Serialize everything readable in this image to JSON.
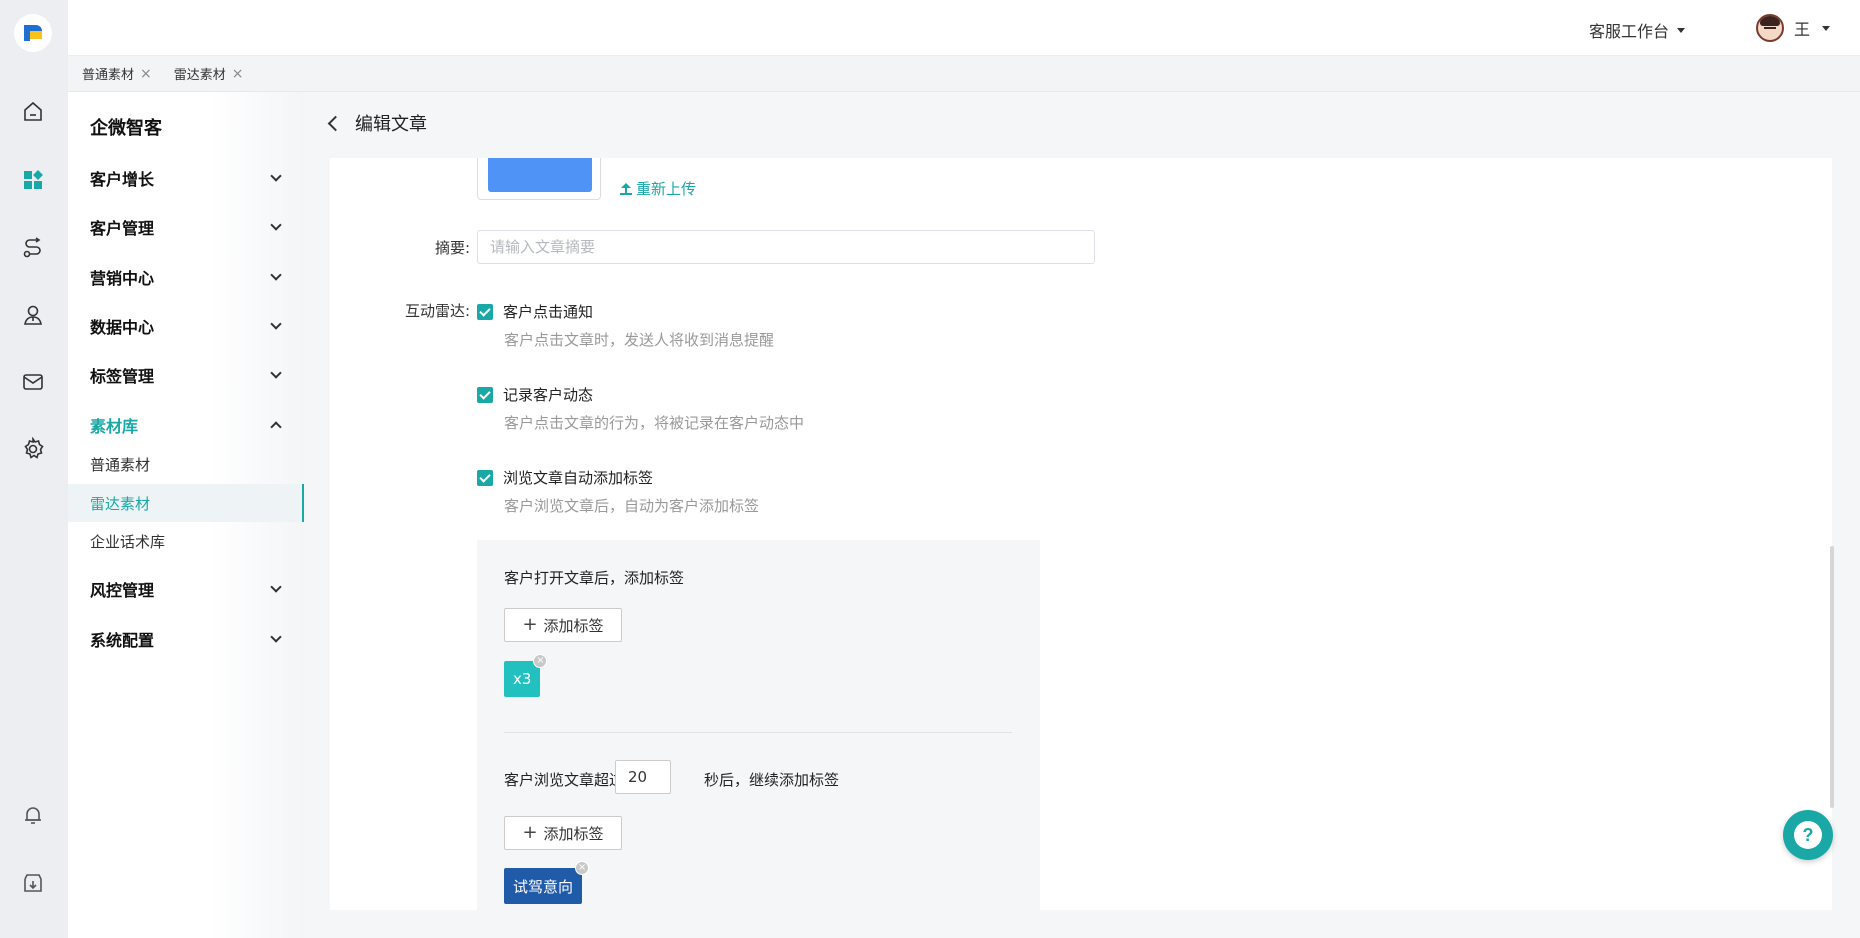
{
  "header": {
    "workspace_label": "客服工作台",
    "user_name": "王"
  },
  "tabs": [
    {
      "label": "普通素材"
    },
    {
      "label": "雷达素材"
    }
  ],
  "sidebar": {
    "brand": "企微智客",
    "menu": [
      {
        "label": "客户增长"
      },
      {
        "label": "客户管理"
      },
      {
        "label": "营销中心"
      },
      {
        "label": "数据中心"
      },
      {
        "label": "标签管理"
      },
      {
        "label": "素材库"
      },
      {
        "label": "风控管理"
      },
      {
        "label": "系统配置"
      }
    ],
    "submenu": [
      {
        "label": "普通素材"
      },
      {
        "label": "雷达素材"
      },
      {
        "label": "企业话术库"
      }
    ]
  },
  "page": {
    "title": "编辑文章",
    "reupload_label": "重新上传",
    "summary_label": "摘要:",
    "summary_placeholder": "请输入文章摘要",
    "radar_label": "互动雷达:",
    "options": [
      {
        "label": "客户点击通知",
        "desc": "客户点击文章时，发送人将收到消息提醒"
      },
      {
        "label": "记录客户动态",
        "desc": "客户点击文章的行为，将被记录在客户动态中"
      },
      {
        "label": "浏览文章自动添加标签",
        "desc": "客户浏览文章后，自动为客户添加标签"
      }
    ],
    "tag_panel": {
      "open_title": "客户打开文章后，添加标签",
      "add_tag_label": "添加标签",
      "open_tags": [
        {
          "label": "x3",
          "color": "#22c1bf"
        }
      ],
      "browse_prefix": "客户浏览文章超过",
      "browse_seconds": "20",
      "browse_suffix": "秒后，继续添加标签",
      "browse_tags": [
        {
          "label": "试驾意向",
          "color": "#1f5ba8"
        }
      ]
    }
  },
  "colors": {
    "accent": "#1aa8a6",
    "brand_logo_blue": "#1f6fd1",
    "brand_logo_yellow": "#f7c21b"
  }
}
